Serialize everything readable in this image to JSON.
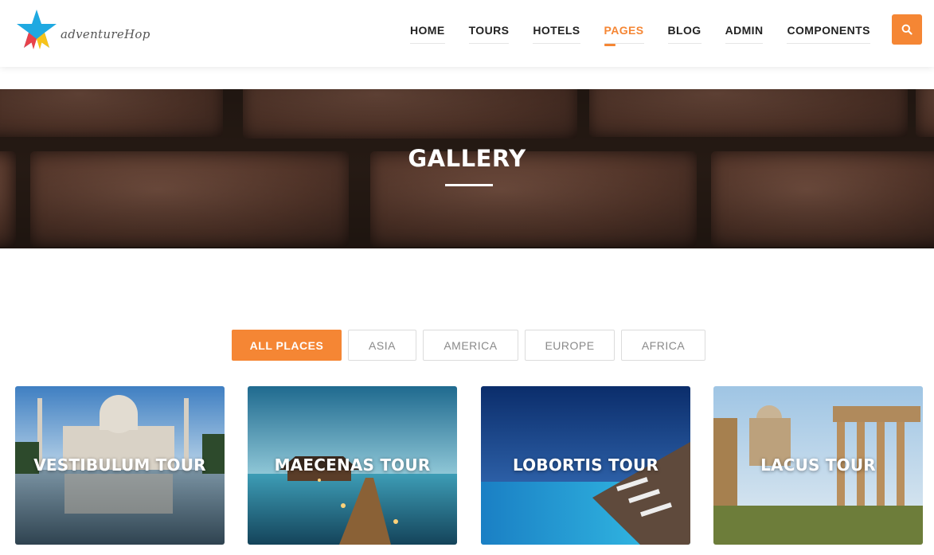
{
  "brand": {
    "logo_text": "adventureHop"
  },
  "nav": {
    "items": [
      {
        "label": "HOME",
        "active": false
      },
      {
        "label": "TOURS",
        "active": false
      },
      {
        "label": "HOTELS",
        "active": false
      },
      {
        "label": "PAGES",
        "active": true
      },
      {
        "label": "BLOG",
        "active": false
      },
      {
        "label": "ADMIN",
        "active": false
      },
      {
        "label": "COMPONENTS",
        "active": false
      }
    ],
    "search_icon": "search-icon"
  },
  "banner": {
    "title": "GALLERY"
  },
  "filters": [
    {
      "label": "ALL PLACES",
      "active": true
    },
    {
      "label": "ASIA",
      "active": false
    },
    {
      "label": "AMERICA",
      "active": false
    },
    {
      "label": "EUROPE",
      "active": false
    },
    {
      "label": "AFRICA",
      "active": false
    }
  ],
  "gallery": [
    {
      "title": "VESTIBULUM TOUR"
    },
    {
      "title": "MAECENAS TOUR"
    },
    {
      "title": "LOBORTIS TOUR"
    },
    {
      "title": "LACUS TOUR"
    }
  ],
  "colors": {
    "accent": "#f58634",
    "text": "#222222",
    "muted": "#8a8a8a"
  }
}
